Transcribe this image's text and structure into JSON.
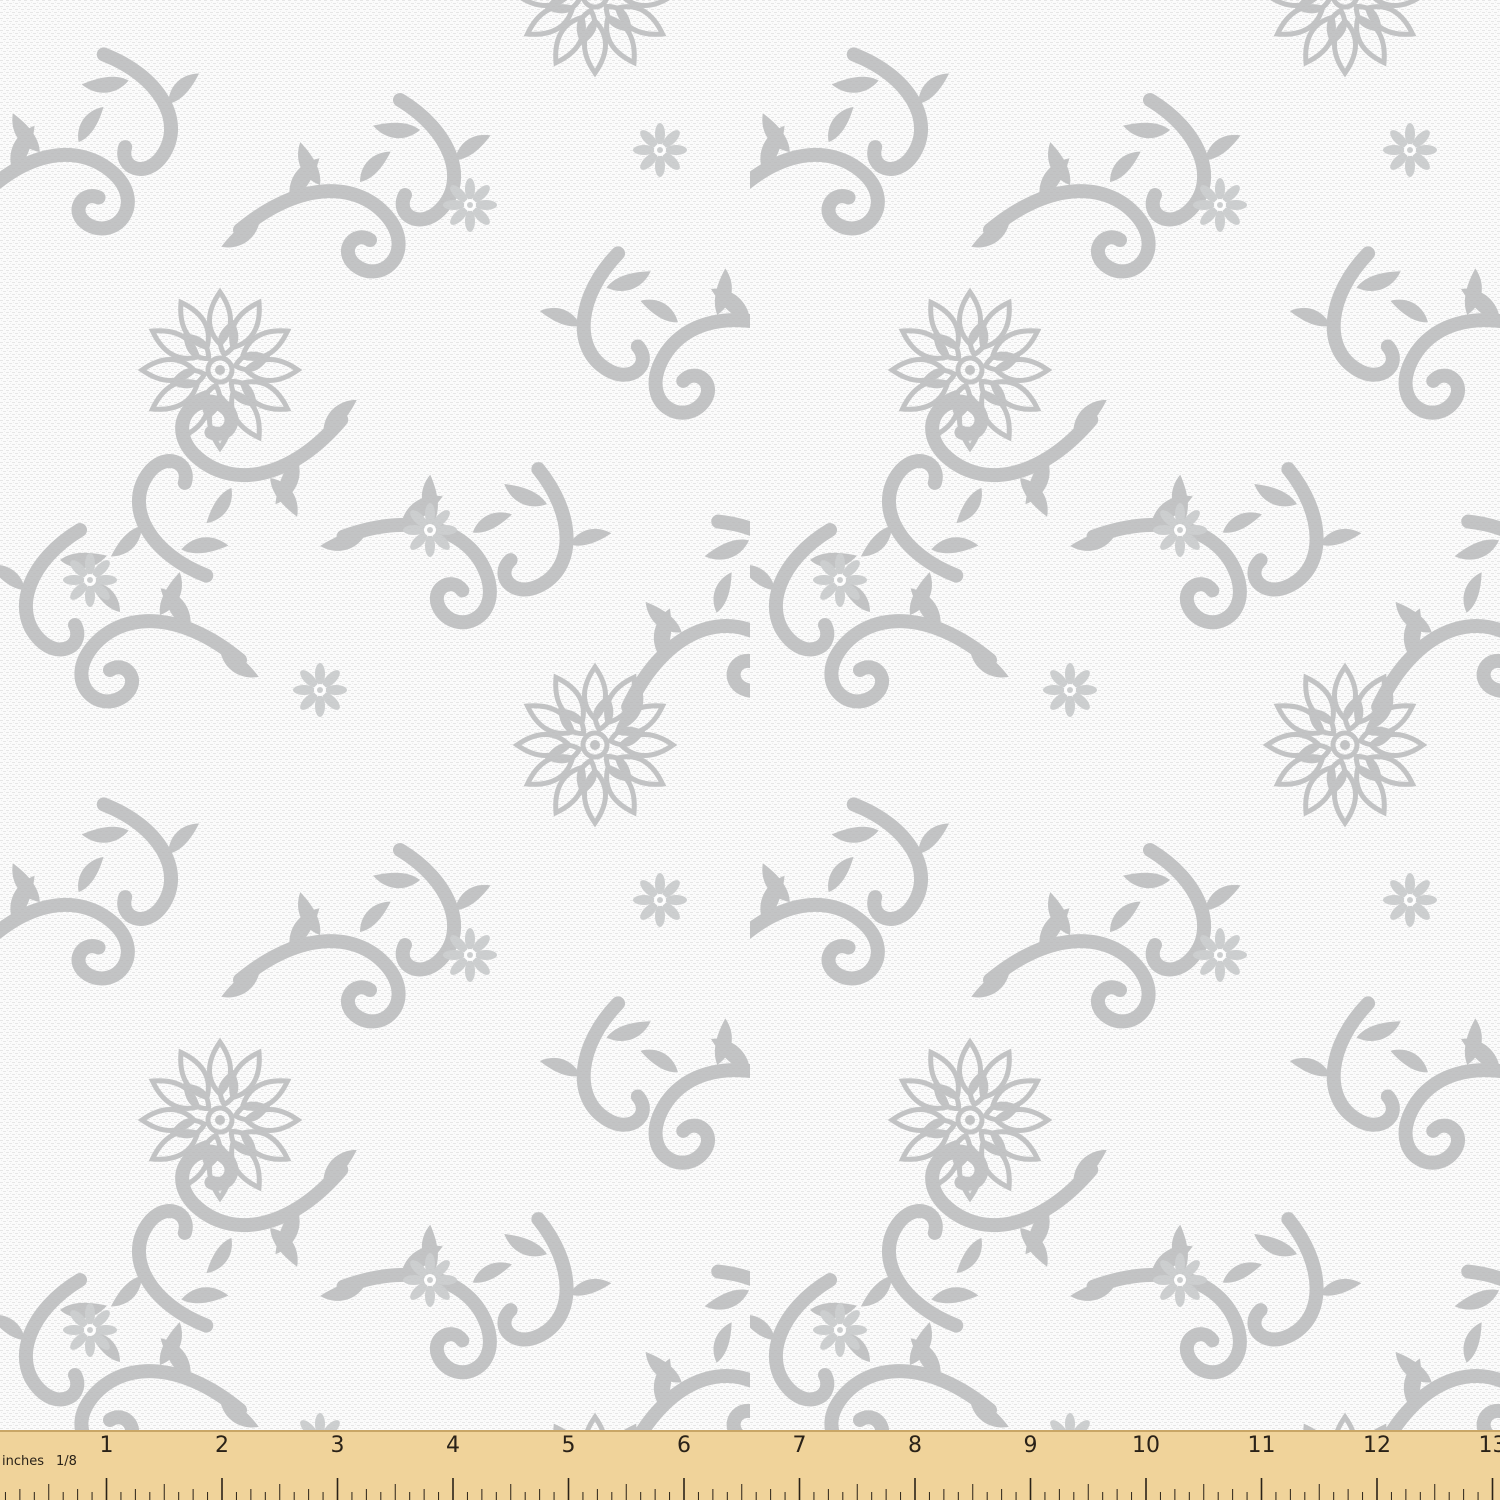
{
  "fabric": {
    "pattern": "grey floral damask swirl print on canvas weave",
    "colors": {
      "background": "#fbfbfb",
      "motif": "#b3b5b6",
      "weave": "#dcdcdc"
    }
  },
  "ruler": {
    "unit_label": "inches",
    "fraction_label": "1/8",
    "numbers": [
      "1",
      "2",
      "3",
      "4",
      "5",
      "6",
      "7",
      "8",
      "9",
      "10",
      "11",
      "12",
      "13"
    ],
    "colors": {
      "wood": "#f0d39a",
      "edge": "#c9a666",
      "marks": "#2a2218"
    }
  }
}
